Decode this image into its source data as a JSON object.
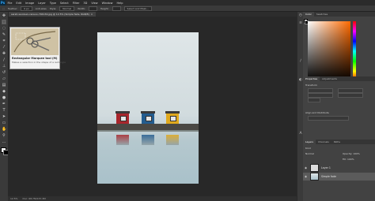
{
  "app": {
    "logo": "Ps"
  },
  "menu": [
    "File",
    "Edit",
    "Image",
    "Layer",
    "Type",
    "Select",
    "Filter",
    "3D",
    "View",
    "Window",
    "Help"
  ],
  "options": {
    "feather_label": "Feather:",
    "feather_value": "0 px",
    "antialias": "Anti-alias",
    "style_label": "Style:",
    "style_value": "Normal",
    "width_label": "Width:",
    "height_label": "Height:",
    "select_mask": "Select and Mask..."
  },
  "document": {
    "tab_label": "sarah-woolven-canuso-794134.jpg @ 12.5% (Simple fade, RGB/8)",
    "close": "×"
  },
  "tooltip": {
    "title": "Rectangular Marquee tool (M)",
    "text": "Makes a selection in the shape of a rectangle"
  },
  "status": {
    "zoom": "12.5%",
    "doc": "Doc: 68.7M/137.3M"
  },
  "panels": {
    "color_tabs": [
      "Color",
      "Swatches"
    ],
    "props_tabs": [
      "Properties",
      "Adjustments"
    ],
    "props_title": "Transform",
    "props_align": "Align and Distribute",
    "layers_tabs": [
      "Layers",
      "Channels",
      "Paths"
    ],
    "layers_kind": "Kind",
    "layers_blend": "Normal",
    "layers_opacity": "Opacity: 100%",
    "layers_fill": "Fill: 100%",
    "layers": [
      {
        "name": "Layer 1",
        "selected": false
      },
      {
        "name": "Simple fade",
        "selected": true
      }
    ]
  },
  "colors": {
    "hut_red": "#a8262c",
    "hut_blue": "#235c8f",
    "hut_yellow": "#e0a91e",
    "accent": "#31a8ff"
  }
}
